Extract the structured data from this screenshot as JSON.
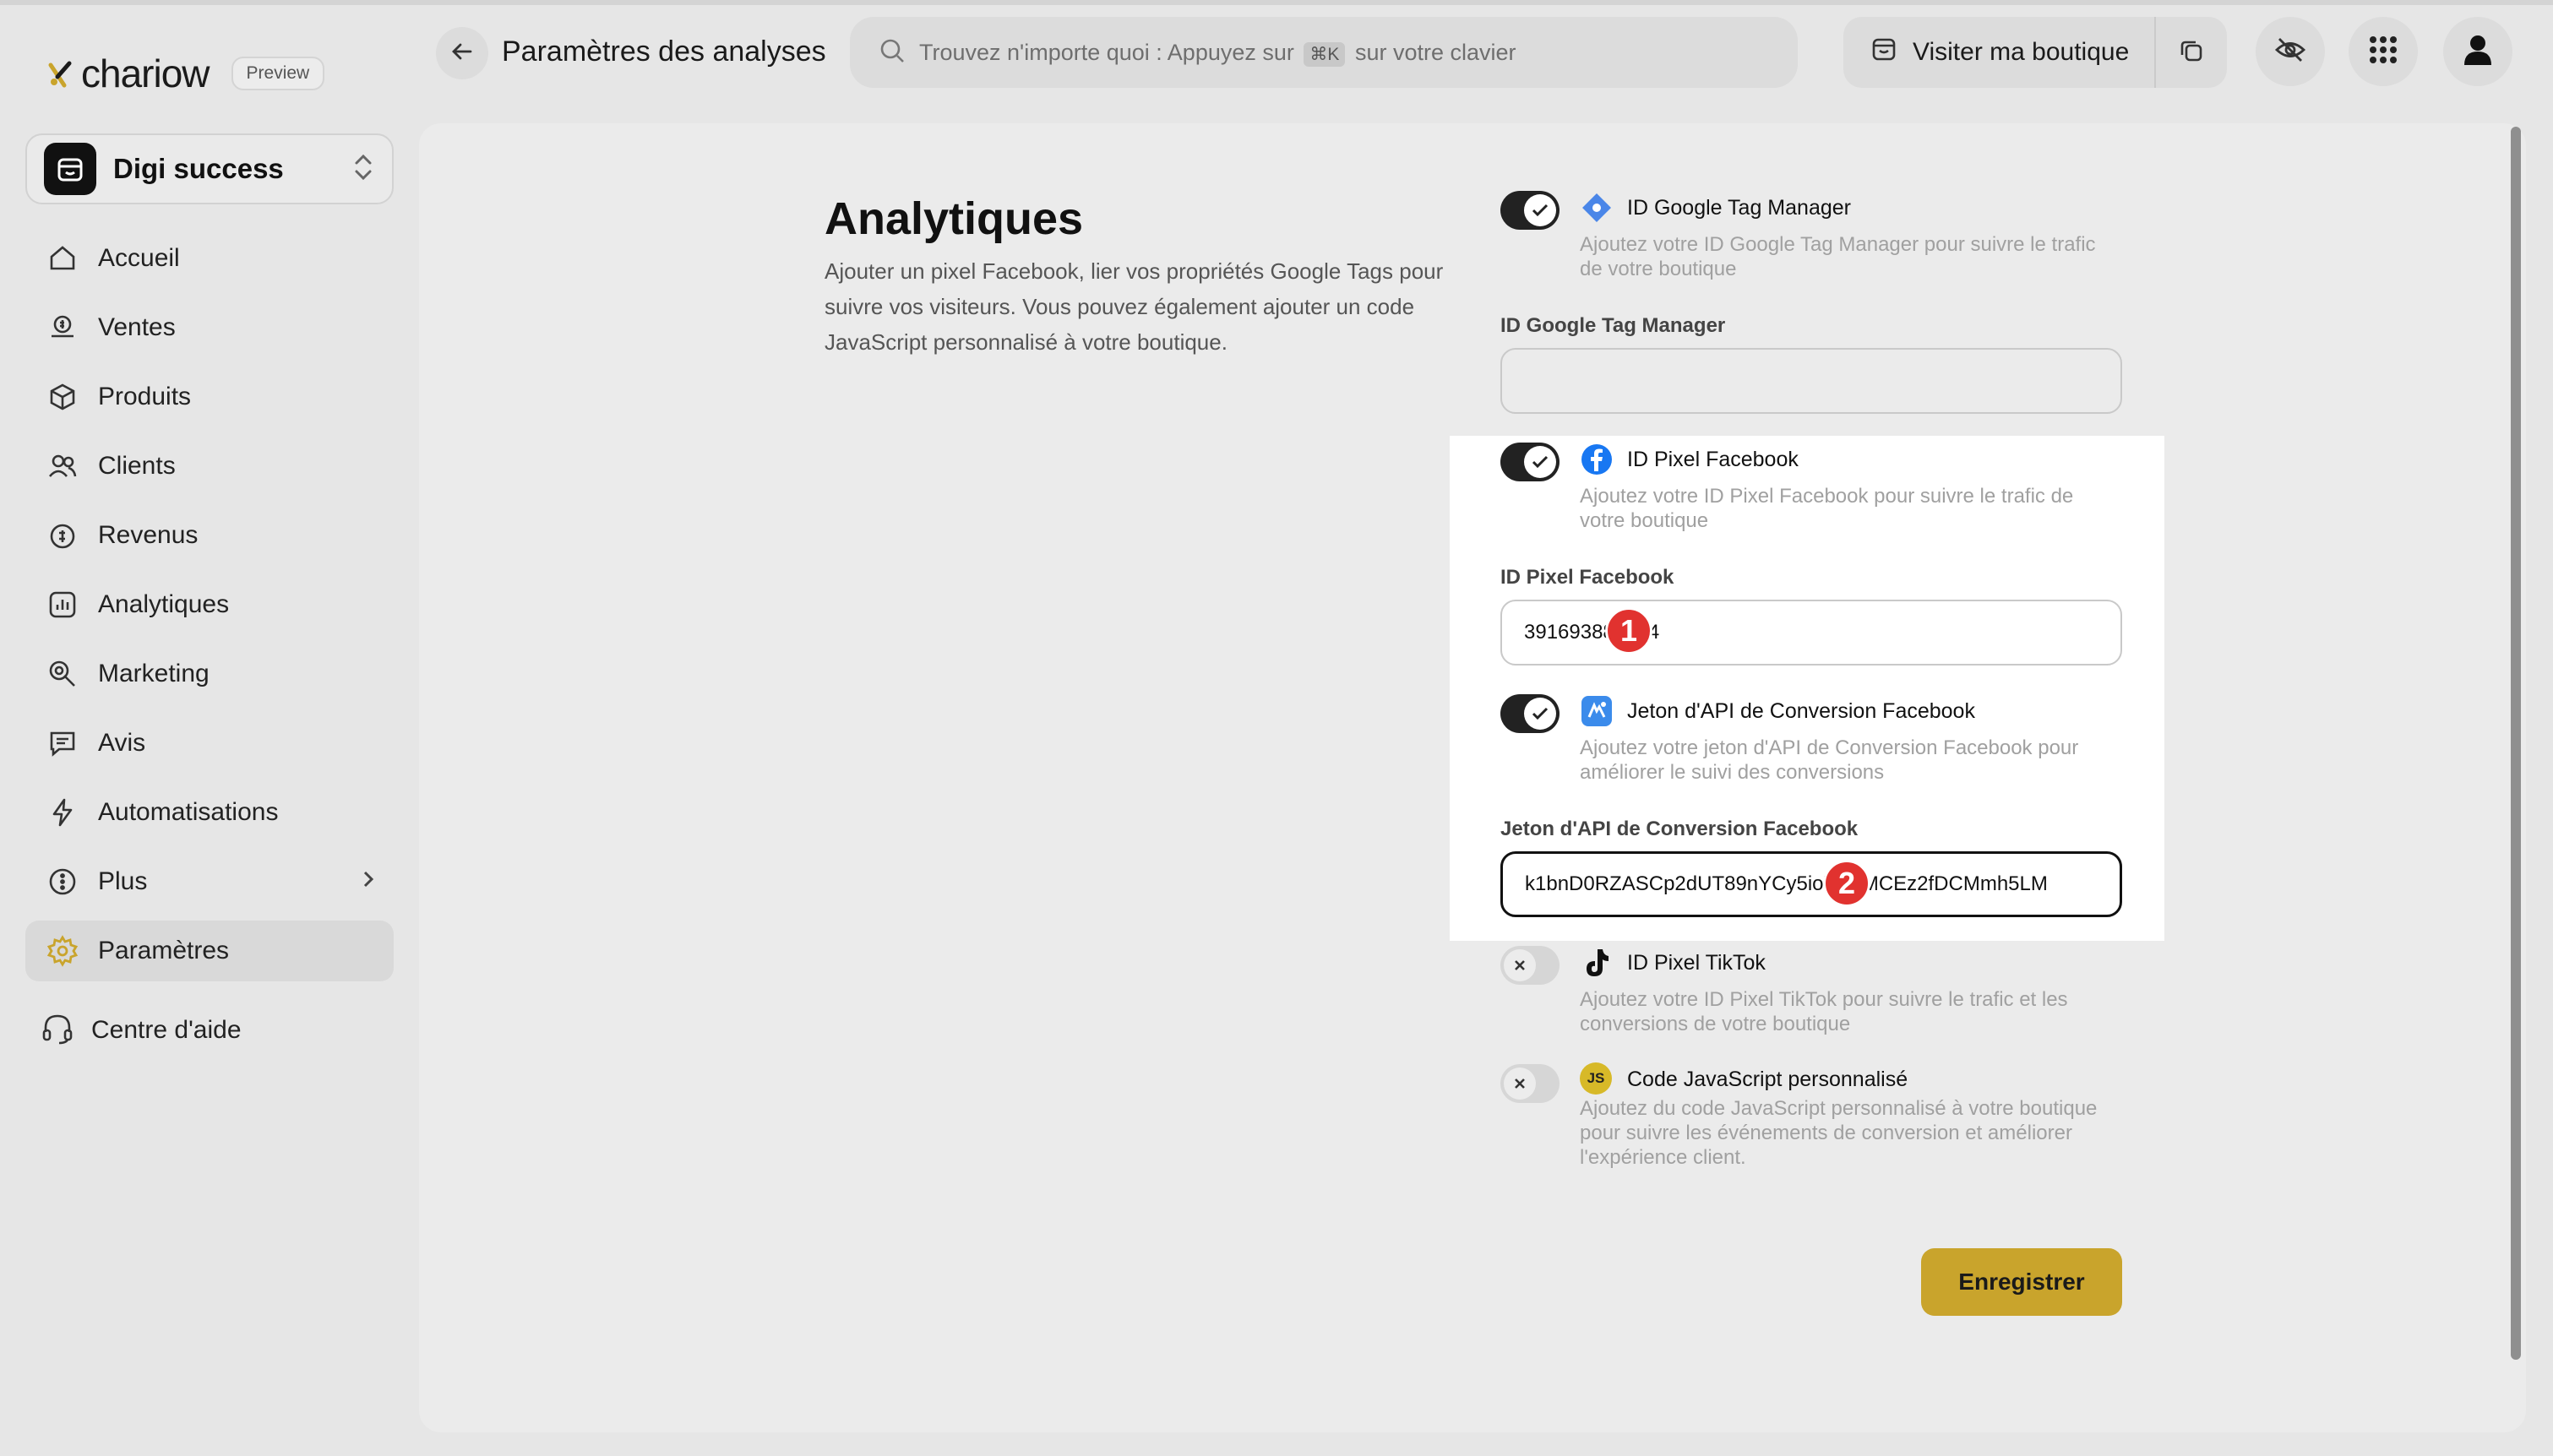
{
  "app": {
    "logo_text": "chariow",
    "preview_badge": "Preview",
    "brand_color": "#c9a42c"
  },
  "store": {
    "name": "Digi success"
  },
  "sidebar": {
    "items": [
      {
        "label": "Accueil",
        "icon": "home-icon"
      },
      {
        "label": "Ventes",
        "icon": "sales-icon"
      },
      {
        "label": "Produits",
        "icon": "box-icon"
      },
      {
        "label": "Clients",
        "icon": "users-icon"
      },
      {
        "label": "Revenus",
        "icon": "revenue-icon"
      },
      {
        "label": "Analytiques",
        "icon": "chart-icon"
      },
      {
        "label": "Marketing",
        "icon": "marketing-icon"
      },
      {
        "label": "Avis",
        "icon": "reviews-icon"
      },
      {
        "label": "Automatisations",
        "icon": "bolt-icon"
      },
      {
        "label": "Plus",
        "icon": "more-icon"
      },
      {
        "label": "Paramètres",
        "icon": "gear-icon",
        "active": true
      }
    ],
    "help_label": "Centre d'aide"
  },
  "header": {
    "title": "Paramètres des analyses",
    "search_prefix": "Trouvez n'importe quoi : Appuyez sur",
    "search_kbd": "⌘K",
    "search_suffix": "sur votre clavier",
    "visit_label": "Visiter ma boutique"
  },
  "page": {
    "title": "Analytiques",
    "description": "Ajouter un pixel Facebook, lier vos propriétés Google Tags pour suivre vos visiteurs. Vous pouvez également ajouter un code JavaScript personnalisé à votre boutique."
  },
  "integrations": {
    "gtm": {
      "title": "ID Google Tag Manager",
      "desc": "Ajoutez votre ID Google Tag Manager pour suivre le trafic de votre boutique",
      "field_label": "ID Google Tag Manager",
      "value": "",
      "enabled": true
    },
    "fb_pixel": {
      "title": "ID Pixel Facebook",
      "desc": "Ajoutez votre ID Pixel Facebook pour suivre le trafic de votre boutique",
      "field_label": "ID Pixel Facebook",
      "value": "391693889844",
      "enabled": true
    },
    "fb_capi": {
      "title": "Jeton d'API de Conversion Facebook",
      "desc": "Ajoutez votre jeton d'API de Conversion Facebook pour améliorer le suivi des conversions",
      "field_label": "Jeton d'API de Conversion Facebook",
      "value": "k1bnD0RZASCp2dUT89nYCy5ioTjtOMCEz2fDCMmh5LM",
      "enabled": true
    },
    "tiktok": {
      "title": "ID Pixel TikTok",
      "desc": "Ajoutez votre ID Pixel TikTok pour suivre le trafic et les conversions de votre boutique",
      "enabled": false
    },
    "custom_js": {
      "title": "Code JavaScript personnalisé",
      "desc": "Ajoutez du code JavaScript personnalisé à votre boutique pour suivre les événements de conversion et améliorer l'expérience client.",
      "badge": "JS",
      "enabled": false
    }
  },
  "markers": {
    "one": "1",
    "two": "2"
  },
  "actions": {
    "save_label": "Enregistrer"
  }
}
